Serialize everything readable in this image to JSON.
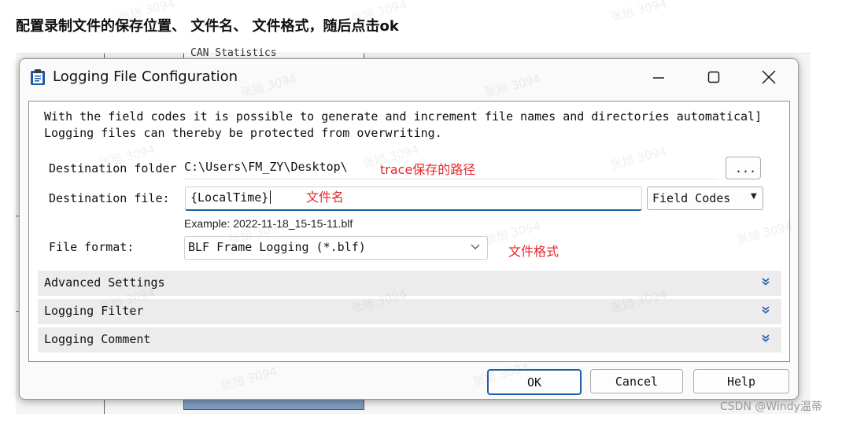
{
  "caption": "配置录制文件的保存位置、 文件名、 文件格式，随后点击ok",
  "background_text": "CAN Statistics",
  "dialog": {
    "title": "Logging File Configuration",
    "info_line1": "With the field codes it is possible to generate and increment file names and directories automatical]",
    "info_line2": "Logging files can thereby be protected from overwriting.",
    "destination_folder_label": "Destination folder",
    "destination_folder_value": "C:\\Users\\FM_ZY\\Desktop\\",
    "browse_label": "...",
    "destination_file_label": "Destination file:",
    "destination_file_value": "{LocalTime}",
    "field_codes_label": "Field Codes",
    "example_text": "Example: 2022-11-18_15-15-11.blf",
    "file_format_label": "File format:",
    "file_format_value": "BLF Frame Logging (*.blf)",
    "sections": [
      "Advanced Settings",
      "Logging Filter",
      "Logging Comment"
    ],
    "buttons": {
      "ok": "OK",
      "cancel": "Cancel",
      "help": "Help"
    }
  },
  "annotations": {
    "path": "trace保存的路径",
    "name": "文件名",
    "format": "文件格式"
  },
  "watermark": "张旭 3094",
  "credit": "CSDN @Windy温蒂",
  "colors": {
    "annotation": "#e8262b",
    "focus": "#1f5fa8"
  }
}
